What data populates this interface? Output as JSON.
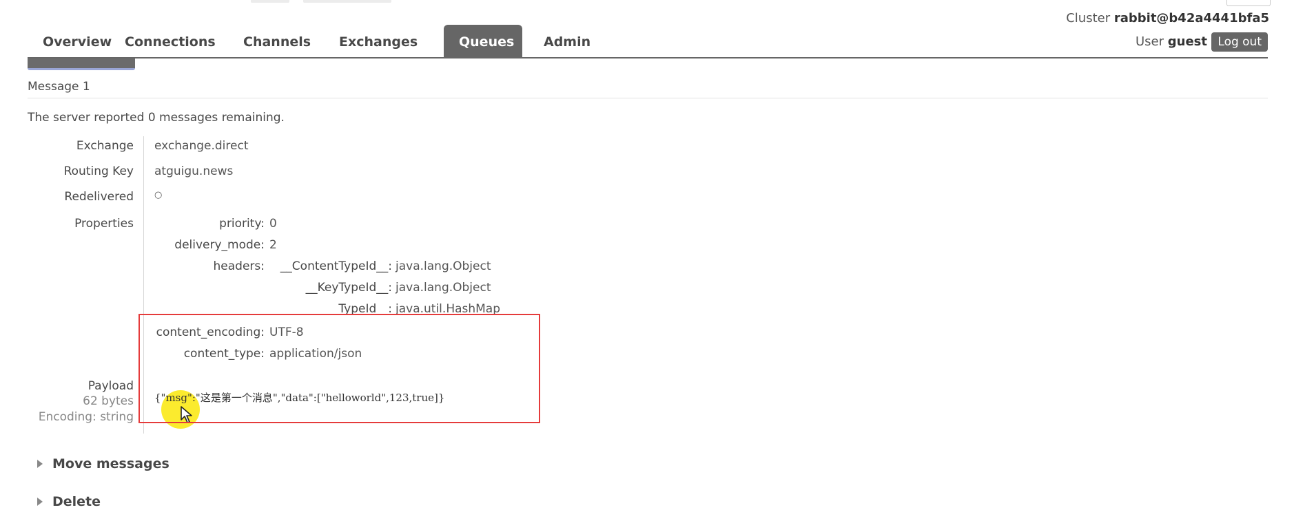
{
  "header": {
    "cluster_label": "Cluster",
    "cluster_name": "rabbit@b42a4441bfa5",
    "user_label": "User",
    "user_name": "guest",
    "logout_label": "Log out"
  },
  "nav": {
    "tabs": [
      {
        "label": "Overview"
      },
      {
        "label": "Connections"
      },
      {
        "label": "Channels"
      },
      {
        "label": "Exchanges"
      },
      {
        "label": "Queues"
      },
      {
        "label": "Admin"
      }
    ],
    "active_tab": "Queues"
  },
  "message": {
    "title": "Message 1",
    "remaining": "The server reported 0 messages remaining.",
    "fields": {
      "exchange_label": "Exchange",
      "exchange_value": "exchange.direct",
      "routing_key_label": "Routing Key",
      "routing_key_value": "atguigu.news",
      "redelivered_label": "Redelivered",
      "redelivered_value": "○",
      "properties_label": "Properties"
    },
    "properties": {
      "priority_key": "priority:",
      "priority_value": "0",
      "delivery_mode_key": "delivery_mode:",
      "delivery_mode_value": "2",
      "headers_key": "headers:",
      "headers": [
        {
          "key": "__ContentTypeId__:",
          "value": "java.lang.Object"
        },
        {
          "key": "__KeyTypeId__:",
          "value": "java.lang.Object"
        },
        {
          "key": "__TypeId__:",
          "value": "java.util.HashMap"
        }
      ],
      "content_encoding_key": "content_encoding:",
      "content_encoding_value": "UTF-8",
      "content_type_key": "content_type:",
      "content_type_value": "application/json"
    },
    "payload": {
      "label": "Payload",
      "size": "62 bytes",
      "encoding": "Encoding: string",
      "body": "{\"msg\":\"这是第一个消息\",\"data\":[\"helloworld\",123,true]}"
    }
  },
  "sections": {
    "move_messages": "Move messages",
    "delete": "Delete"
  },
  "colors": {
    "tab_active_bg": "#666666",
    "highlight_border": "#e53b3b",
    "cursor_highlight": "#fae600"
  }
}
